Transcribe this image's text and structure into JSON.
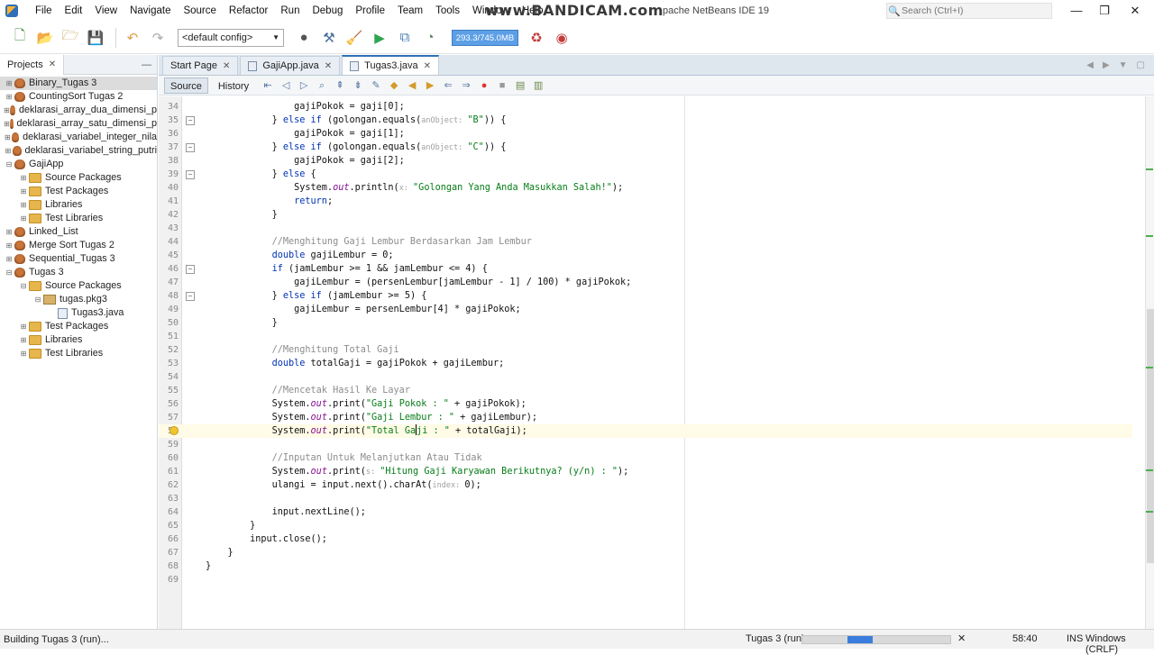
{
  "titlebar": {
    "menu": [
      "File",
      "Edit",
      "View",
      "Navigate",
      "Source",
      "Refactor",
      "Run",
      "Debug",
      "Profile",
      "Team",
      "Tools",
      "Window",
      "Help"
    ],
    "watermark": "www.BANDICAM.com",
    "title_suffix": "pache NetBeans IDE 19",
    "search_placeholder": "Search (Ctrl+I)",
    "minimize": "—",
    "maximize": "❐",
    "close": "✕"
  },
  "toolbar": {
    "config": "<default config>",
    "memory": "293.3/745.0MB"
  },
  "projects": {
    "tab_label": "Projects",
    "close": "✕",
    "minimize": "—",
    "tree": [
      {
        "label": "Binary_Tugas 3",
        "icon": "project-icon",
        "indent": 0,
        "toggle": "⊞",
        "selected": true
      },
      {
        "label": "CountingSort Tugas 2",
        "icon": "project-icon",
        "indent": 0,
        "toggle": "⊞"
      },
      {
        "label": "deklarasi_array_dua_dimensi_p",
        "icon": "project-icon",
        "indent": 0,
        "toggle": "⊞"
      },
      {
        "label": "deklarasi_array_satu_dimensi_p",
        "icon": "project-icon",
        "indent": 0,
        "toggle": "⊞"
      },
      {
        "label": "deklarasi_variabel_integer_nila",
        "icon": "project-icon",
        "indent": 0,
        "toggle": "⊞"
      },
      {
        "label": "deklarasi_variabel_string_putri",
        "icon": "project-icon",
        "indent": 0,
        "toggle": "⊞"
      },
      {
        "label": "GajiApp",
        "icon": "project-icon",
        "indent": 0,
        "toggle": "⊟"
      },
      {
        "label": "Source Packages",
        "icon": "folder-icon",
        "indent": 1,
        "toggle": "⊞"
      },
      {
        "label": "Test Packages",
        "icon": "folder-icon",
        "indent": 1,
        "toggle": "⊞"
      },
      {
        "label": "Libraries",
        "icon": "folder-icon",
        "indent": 1,
        "toggle": "⊞"
      },
      {
        "label": "Test Libraries",
        "icon": "folder-icon",
        "indent": 1,
        "toggle": "⊞"
      },
      {
        "label": "Linked_List",
        "icon": "project-icon",
        "indent": 0,
        "toggle": "⊞"
      },
      {
        "label": "Merge Sort Tugas 2",
        "icon": "project-icon",
        "indent": 0,
        "toggle": "⊞"
      },
      {
        "label": "Sequential_Tugas 3",
        "icon": "project-icon",
        "indent": 0,
        "toggle": "⊞"
      },
      {
        "label": "Tugas 3",
        "icon": "project-icon",
        "indent": 0,
        "toggle": "⊟"
      },
      {
        "label": "Source Packages",
        "icon": "folder-icon",
        "indent": 1,
        "toggle": "⊟"
      },
      {
        "label": "tugas.pkg3",
        "icon": "package-icon",
        "indent": 2,
        "toggle": "⊟"
      },
      {
        "label": "Tugas3.java",
        "icon": "java-file-icon",
        "indent": 3,
        "toggle": ""
      },
      {
        "label": "Test Packages",
        "icon": "folder-icon",
        "indent": 1,
        "toggle": "⊞"
      },
      {
        "label": "Libraries",
        "icon": "folder-icon",
        "indent": 1,
        "toggle": "⊞"
      },
      {
        "label": "Test Libraries",
        "icon": "folder-icon",
        "indent": 1,
        "toggle": "⊞"
      }
    ]
  },
  "editor": {
    "tabs": [
      {
        "label": "Start Page",
        "active": false
      },
      {
        "label": "GajiApp.java",
        "active": false
      },
      {
        "label": "Tugas3.java",
        "active": true
      }
    ],
    "tab_close": "✕",
    "view_source": "Source",
    "view_history": "History",
    "lines": [
      {
        "n": "34",
        "segs": [
          [
            "",
            "                gajiPokok = gaji[0];"
          ]
        ]
      },
      {
        "n": "35",
        "fold": "⊟",
        "segs": [
          [
            "",
            "            } "
          ],
          [
            "kw",
            "else if"
          ],
          [
            "",
            " (golongan.equals("
          ],
          [
            "hint",
            "anObject: "
          ],
          [
            "str",
            "\"B\""
          ],
          [
            "",
            ")) {"
          ]
        ]
      },
      {
        "n": "36",
        "segs": [
          [
            "",
            "                gajiPokok = gaji[1];"
          ]
        ]
      },
      {
        "n": "37",
        "fold": "⊟",
        "segs": [
          [
            "",
            "            } "
          ],
          [
            "kw",
            "else if"
          ],
          [
            "",
            " (golongan.equals("
          ],
          [
            "hint",
            "anObject: "
          ],
          [
            "str",
            "\"C\""
          ],
          [
            "",
            ")) {"
          ]
        ]
      },
      {
        "n": "38",
        "segs": [
          [
            "",
            "                gajiPokok = gaji[2];"
          ]
        ]
      },
      {
        "n": "39",
        "fold": "⊟",
        "segs": [
          [
            "",
            "            } "
          ],
          [
            "kw",
            "else"
          ],
          [
            "",
            " {"
          ]
        ]
      },
      {
        "n": "40",
        "segs": [
          [
            "",
            "                System."
          ],
          [
            "field",
            "out"
          ],
          [
            "",
            ".println("
          ],
          [
            "hint",
            "x: "
          ],
          [
            "str",
            "\"Golongan Yang Anda Masukkan Salah!\""
          ],
          [
            "",
            ");"
          ]
        ]
      },
      {
        "n": "41",
        "segs": [
          [
            "",
            "                "
          ],
          [
            "kw",
            "return"
          ],
          [
            "",
            ";"
          ]
        ]
      },
      {
        "n": "42",
        "segs": [
          [
            "",
            "            }"
          ]
        ]
      },
      {
        "n": "43",
        "segs": [
          [
            "",
            ""
          ]
        ]
      },
      {
        "n": "44",
        "segs": [
          [
            "cmt",
            "            //Menghitung Gaji Lembur Berdasarkan Jam Lembur"
          ]
        ]
      },
      {
        "n": "45",
        "segs": [
          [
            "",
            "            "
          ],
          [
            "kw",
            "double"
          ],
          [
            "",
            " gajiLembur = 0;"
          ]
        ]
      },
      {
        "n": "46",
        "fold": "⊟",
        "segs": [
          [
            "",
            "            "
          ],
          [
            "kw",
            "if"
          ],
          [
            "",
            " (jamLembur >= 1 && jamLembur <= 4) {"
          ]
        ]
      },
      {
        "n": "47",
        "segs": [
          [
            "",
            "                gajiLembur = (persenLembur[jamLembur - 1] / 100) * gajiPokok;"
          ]
        ]
      },
      {
        "n": "48",
        "fold": "⊟",
        "segs": [
          [
            "",
            "            } "
          ],
          [
            "kw",
            "else if"
          ],
          [
            "",
            " (jamLembur >= 5) {"
          ]
        ]
      },
      {
        "n": "49",
        "segs": [
          [
            "",
            "                gajiLembur = persenLembur[4] * gajiPokok;"
          ]
        ]
      },
      {
        "n": "50",
        "segs": [
          [
            "",
            "            }"
          ]
        ]
      },
      {
        "n": "51",
        "segs": [
          [
            "",
            ""
          ]
        ]
      },
      {
        "n": "52",
        "segs": [
          [
            "cmt",
            "            //Menghitung Total Gaji"
          ]
        ]
      },
      {
        "n": "53",
        "segs": [
          [
            "",
            "            "
          ],
          [
            "kw",
            "double"
          ],
          [
            "",
            " totalGaji = gajiPokok + gajiLembur;"
          ]
        ]
      },
      {
        "n": "54",
        "segs": [
          [
            "",
            ""
          ]
        ]
      },
      {
        "n": "55",
        "segs": [
          [
            "cmt",
            "            //Mencetak Hasil Ke Layar"
          ]
        ]
      },
      {
        "n": "56",
        "segs": [
          [
            "",
            "            System."
          ],
          [
            "field",
            "out"
          ],
          [
            "",
            ".print("
          ],
          [
            "str",
            "\"Gaji Pokok : \""
          ],
          [
            "",
            " + gajiPokok);"
          ]
        ]
      },
      {
        "n": "57",
        "segs": [
          [
            "",
            "            System."
          ],
          [
            "field",
            "out"
          ],
          [
            "",
            ".print("
          ],
          [
            "str",
            "\"Gaji Lembur : \""
          ],
          [
            "",
            " + gajiLembur);"
          ]
        ]
      },
      {
        "n": "58",
        "bulb": true,
        "hl": true,
        "segs": [
          [
            "",
            "            System."
          ],
          [
            "field",
            "out"
          ],
          [
            "",
            ".print("
          ],
          [
            "str",
            "\"Total Ga"
          ],
          [
            "caret",
            ""
          ],
          [
            "str",
            "ji : \""
          ],
          [
            "",
            " + totalGaji);"
          ]
        ]
      },
      {
        "n": "59",
        "segs": [
          [
            "",
            ""
          ]
        ]
      },
      {
        "n": "60",
        "segs": [
          [
            "cmt",
            "            //Inputan Untuk Melanjutkan Atau Tidak"
          ]
        ]
      },
      {
        "n": "61",
        "segs": [
          [
            "",
            "            System."
          ],
          [
            "field",
            "out"
          ],
          [
            "",
            ".print("
          ],
          [
            "hint",
            "s: "
          ],
          [
            "str",
            "\"Hitung Gaji Karyawan Berikutnya? (y/n) : \""
          ],
          [
            "",
            ");"
          ]
        ]
      },
      {
        "n": "62",
        "segs": [
          [
            "",
            "            ulangi = input.next().charAt("
          ],
          [
            "hint",
            "index: "
          ],
          [
            "",
            "0);"
          ]
        ]
      },
      {
        "n": "63",
        "segs": [
          [
            "",
            ""
          ]
        ]
      },
      {
        "n": "64",
        "segs": [
          [
            "",
            "            input.nextLine();"
          ]
        ]
      },
      {
        "n": "65",
        "segs": [
          [
            "",
            "        }"
          ]
        ]
      },
      {
        "n": "66",
        "segs": [
          [
            "",
            "        input.close();"
          ]
        ]
      },
      {
        "n": "67",
        "segs": [
          [
            "",
            "    }"
          ]
        ]
      },
      {
        "n": "68",
        "segs": [
          [
            "",
            "}"
          ]
        ]
      },
      {
        "n": "69",
        "segs": [
          [
            "",
            ""
          ]
        ]
      }
    ]
  },
  "statusbar": {
    "left": "Building Tugas 3 (run)...",
    "project": "Tugas 3 (run)",
    "progress": 0.2,
    "close": "✕",
    "position": "58:40",
    "mode": "INS",
    "eol": "Windows (CRLF)"
  },
  "colors": {
    "keyword": "#0033b3",
    "string": "#067d17",
    "comment": "#8c8c8c",
    "field": "#871094",
    "accent": "#2f6fb7"
  }
}
